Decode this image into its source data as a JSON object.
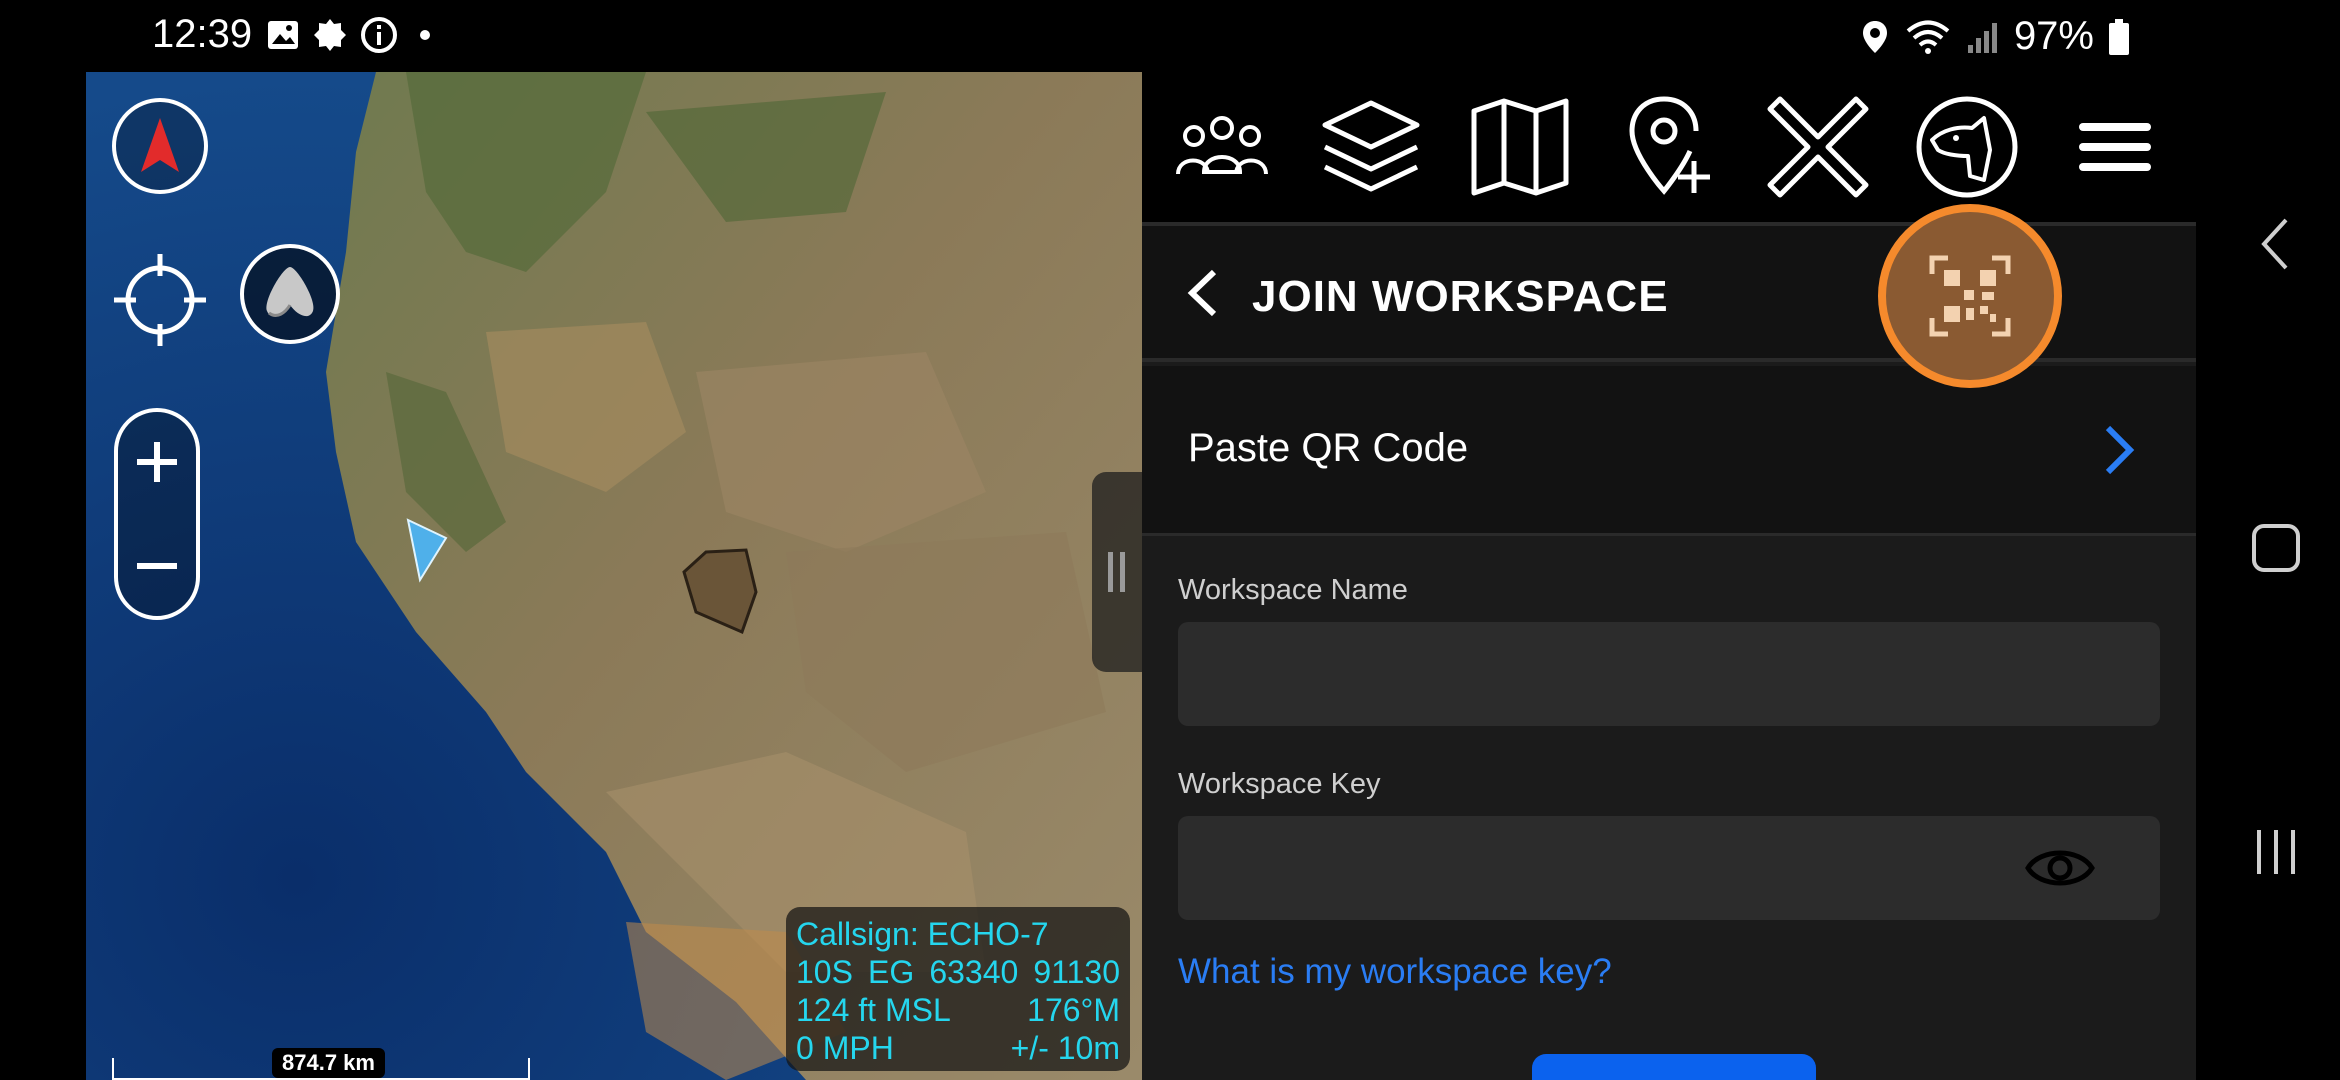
{
  "status_bar": {
    "time": "12:39",
    "left_icons": [
      "gallery-icon",
      "badge-icon",
      "info-icon",
      "dot-icon"
    ],
    "right_icons": [
      "location-icon",
      "wifi-icon",
      "signal-icon"
    ],
    "battery_percent": "97%"
  },
  "map": {
    "info": {
      "callsign": "Callsign: ECHO-7",
      "grid_zone": "10S",
      "grid_square": "EG",
      "easting": "63340",
      "northing": "91130",
      "altitude": "124 ft MSL",
      "heading": "176°M",
      "speed": "0 MPH",
      "accuracy": "+/- 10m"
    },
    "scale_label": "874.7 km"
  },
  "toolbar": {
    "icons": [
      "team-icon",
      "layers-icon",
      "map-icon",
      "add-waypoint-icon",
      "close-icon",
      "dog-icon",
      "menu-icon"
    ]
  },
  "panel": {
    "title": "JOIN WORKSPACE",
    "paste_label": "Paste QR Code",
    "workspace_name_label": "Workspace Name",
    "workspace_name_value": "",
    "workspace_key_label": "Workspace Key",
    "workspace_key_value": "",
    "help_link": "What is my workspace key?"
  },
  "colors": {
    "accent_orange": "#f58a2c",
    "link_blue": "#2a7df4",
    "primary_blue": "#0b62ee",
    "info_text": "#25d6ee"
  }
}
